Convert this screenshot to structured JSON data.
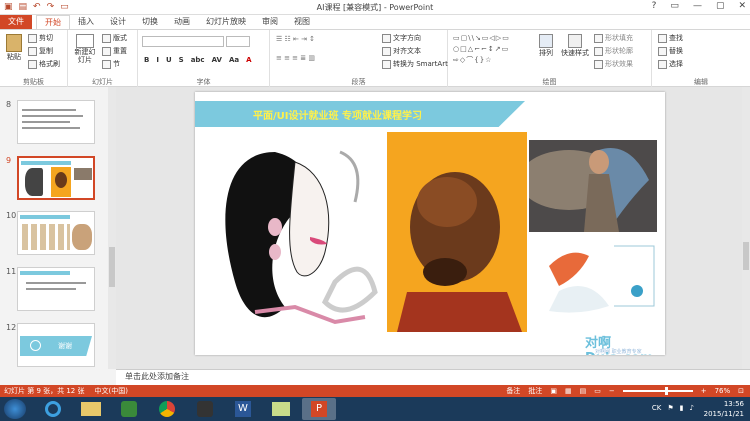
{
  "window": {
    "title": "AI课程 [兼容模式] - PowerPoint",
    "controls": [
      "?",
      "▭",
      "—",
      "▢",
      "✕"
    ]
  },
  "tabs": [
    "文件",
    "开始",
    "插入",
    "设计",
    "切换",
    "动画",
    "幻灯片放映",
    "审阅",
    "视图"
  ],
  "ribbon": {
    "clipboard": {
      "label": "剪贴板",
      "paste": "粘贴",
      "cut": "剪切",
      "copy": "复制",
      "format_painter": "格式刷"
    },
    "slides": {
      "label": "幻灯片",
      "new_slide": "新建幻灯片",
      "layout": "版式",
      "reset": "重置",
      "section": "节"
    },
    "font": {
      "label": "字体",
      "buttons": [
        "B",
        "I",
        "U",
        "S",
        "abc",
        "AV",
        "Aa",
        "A"
      ]
    },
    "paragraph": {
      "label": "段落",
      "text_direction": "文字方向",
      "align_text": "对齐文本",
      "smartart": "转换为 SmartArt"
    },
    "drawing": {
      "label": "绘图",
      "arrange": "排列",
      "quick_styles": "快速样式",
      "shape_fill": "形状填充",
      "shape_outline": "形状轮廓",
      "shape_effects": "形状效果"
    },
    "editing": {
      "label": "编辑",
      "find": "查找",
      "replace": "替换",
      "select": "选择"
    }
  },
  "slides_panel": [
    {
      "number": "8",
      "selected": false
    },
    {
      "number": "9",
      "selected": true
    },
    {
      "number": "10",
      "selected": false
    },
    {
      "number": "11",
      "selected": false
    },
    {
      "number": "12",
      "selected": false,
      "caption": "谢谢"
    }
  ],
  "slide": {
    "title": "平面/UI设计就业班 专项就业课程学习",
    "watermark": "对啊Duia.com",
    "watermark_sub": "对啊网 职业教育专家"
  },
  "notes_placeholder": "单击此处添加备注",
  "status": {
    "slide_info": "幻灯片 第 9 张，共 12 张",
    "language": "中文(中国)",
    "notes": "备注",
    "comments": "批注",
    "zoom": "76%",
    "zoom_level": 0.76
  },
  "taskbar": {
    "lang": "CK",
    "time": "13:56",
    "date": "2015/11/21"
  },
  "colors": {
    "accent": "#d24726",
    "banner": "#7cc9de",
    "orange": "#f5a51f",
    "taskbar": "#1b3a5a"
  }
}
